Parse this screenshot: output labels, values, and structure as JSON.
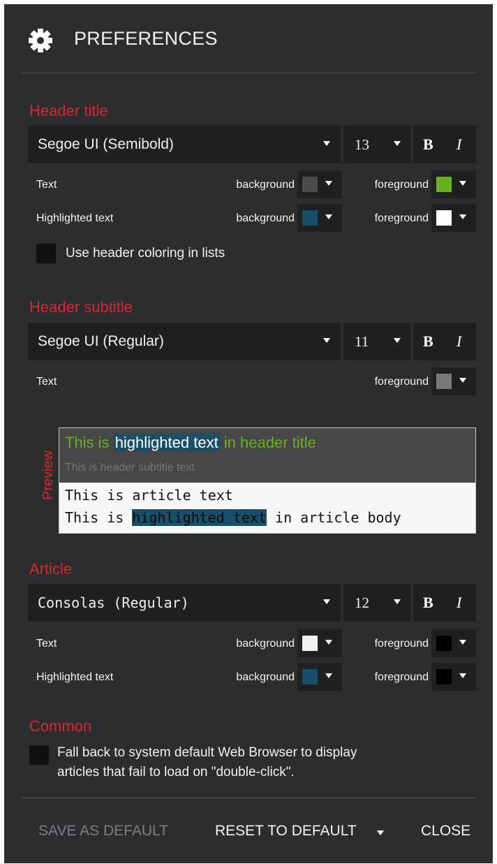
{
  "title": "PREFERENCES",
  "header_title": {
    "section_label": "Header title",
    "font": "Segoe UI (Semibold)",
    "size": "13",
    "bold_label": "B",
    "italic_label": "I",
    "rows": [
      {
        "label": "Text",
        "background_label": "background",
        "background_color": "#4a4a4a",
        "foreground_label": "foreground",
        "foreground_color": "#6ab01e"
      },
      {
        "label": "Highlighted text",
        "background_label": "background",
        "background_color": "#1a4f6b",
        "foreground_label": "foreground",
        "foreground_color": "#ffffff"
      }
    ],
    "checkbox_label": "Use header coloring in lists"
  },
  "header_subtitle": {
    "section_label": "Header subtitle",
    "font": "Segoe UI (Regular)",
    "size": "11",
    "bold_label": "B",
    "italic_label": "I",
    "row": {
      "label": "Text",
      "foreground_label": "foreground",
      "foreground_color": "#7a7a7a"
    }
  },
  "preview": {
    "tag": "Preview",
    "title_before": "This is",
    "title_highlight": "highlighted text",
    "title_after": "in header title",
    "subtitle": "This is header subtitle text",
    "article_line1": "This is article text",
    "article_line2_before": "This is ",
    "article_line2_highlight": "highlighted text",
    "article_line2_after": " in article body"
  },
  "article": {
    "section_label": "Article",
    "font": "Consolas (Regular)",
    "size": "12",
    "bold_label": "B",
    "italic_label": "I",
    "rows": [
      {
        "label": "Text",
        "background_label": "background",
        "background_color": "#f0f0f0",
        "foreground_label": "foreground",
        "foreground_color": "#000000"
      },
      {
        "label": "Highlighted text",
        "background_label": "background",
        "background_color": "#1a4f6b",
        "foreground_label": "foreground",
        "foreground_color": "#000000"
      }
    ]
  },
  "common": {
    "section_label": "Common",
    "checkbox_line1": "Fall back to system default Web Browser to display",
    "checkbox_line2": "articles that fail to load on \"double-click\"."
  },
  "footer": {
    "save_default": "SAVE AS DEFAULT",
    "reset_default": "RESET TO DEFAULT",
    "close": "CLOSE"
  },
  "colors": {
    "accent": "#d7282f",
    "panel": "#2b2d2f",
    "control": "#1e2022"
  }
}
